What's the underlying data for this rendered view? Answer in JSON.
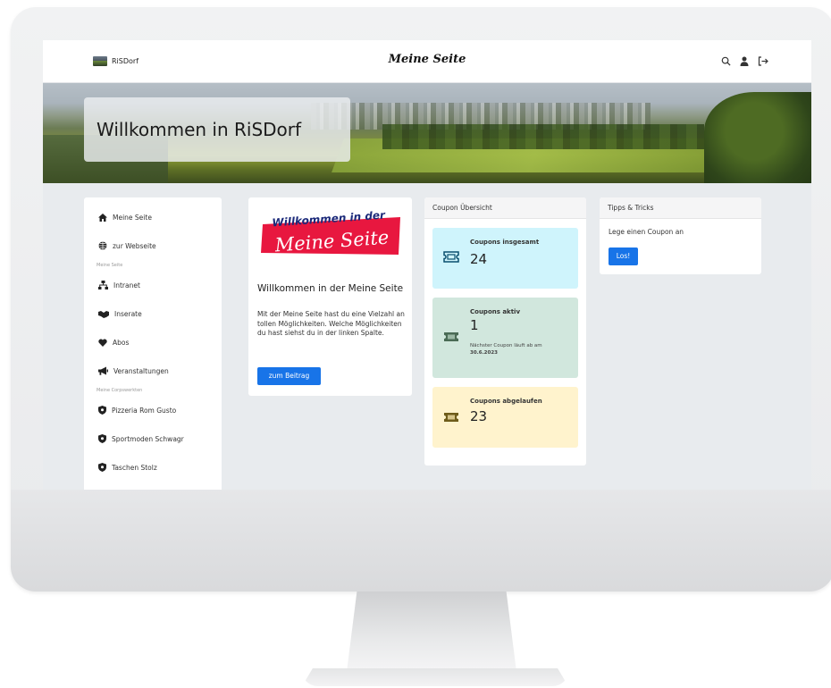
{
  "navbar": {
    "brand": "RiSDorf",
    "title": "Meine Seite",
    "icons": [
      "search-icon",
      "user-icon",
      "logout-icon"
    ]
  },
  "hero": {
    "title": "Willkommen in RiSDorf"
  },
  "sidebar": {
    "items": [
      {
        "label": "Meine Seite",
        "icon": "home-icon"
      },
      {
        "label": "zur Webseite",
        "icon": "globe-icon"
      },
      {
        "section": "Meine Seite"
      },
      {
        "label": "Intranet",
        "icon": "network-icon"
      },
      {
        "label": "Inserate",
        "icon": "handshake-icon"
      },
      {
        "label": "Abos",
        "icon": "heart-icon"
      },
      {
        "label": "Veranstaltungen",
        "icon": "megaphone-icon"
      },
      {
        "section": "Meine Corpswerkten"
      },
      {
        "label": "Pizzeria Rom Gusto",
        "icon": "shield-icon"
      },
      {
        "label": "Sportmoden Schwagr",
        "icon": "shield-icon"
      },
      {
        "label": "Taschen Stolz",
        "icon": "shield-icon"
      }
    ]
  },
  "welcome": {
    "logo_line1": "Willkommen in der",
    "logo_line2": "Meine Seite",
    "title": "Willkommen in der Meine Seite",
    "text": "Mit der Meine Seite hast du eine Vielzahl an tollen Möglichkeiten. Welche Möglichkeiten du hast siehst du in der linken Spalte.",
    "button": "zum Beitrag"
  },
  "coupons": {
    "header": "Coupon Übersicht",
    "total": {
      "label": "Coupons insgesamt",
      "value": "24",
      "bg": "#cff4fc"
    },
    "active": {
      "label": "Coupons aktiv",
      "value": "1",
      "note_prefix": "Nächster Coupon läuft ab am",
      "note_date": "30.6.2023",
      "bg": "#d1e7dd"
    },
    "expired": {
      "label": "Coupons abgelaufen",
      "value": "23",
      "bg": "#fff3cd"
    }
  },
  "tips": {
    "header": "Tipps & Tricks",
    "text": "Lege einen Coupon an",
    "button": "Los!"
  },
  "colors": {
    "primary": "#1874e8",
    "ticket_blue": "#0a4f6e",
    "ticket_green": "#4a6b55",
    "ticket_yellow": "#6e5c1a"
  }
}
